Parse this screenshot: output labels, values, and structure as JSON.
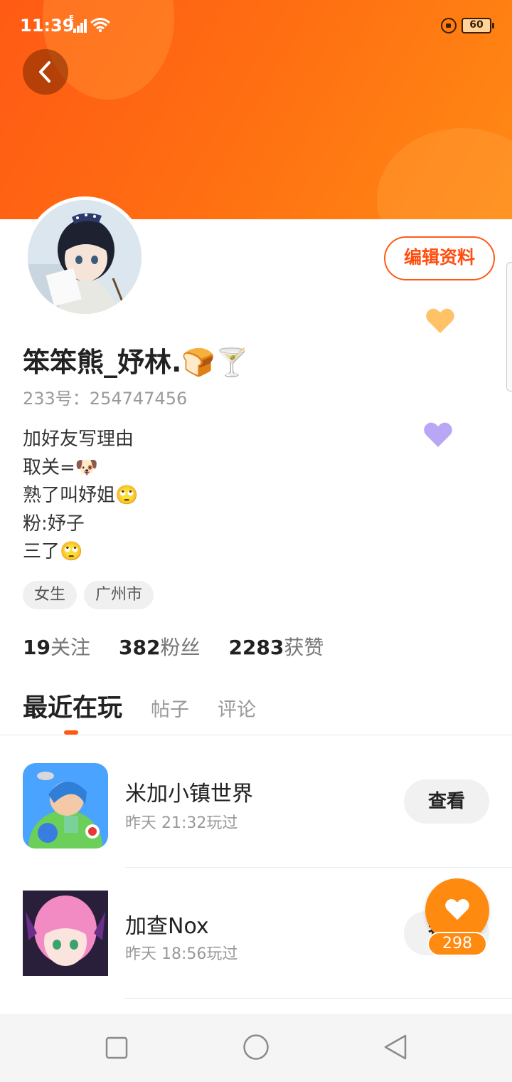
{
  "status_bar": {
    "time": "11:39",
    "network": "E",
    "battery": "60"
  },
  "profile": {
    "name": "笨笨熊_妤林.🍞🍸",
    "uid": "233号：254747456",
    "edit_label": "编辑资料",
    "bio": [
      "加好友写理由",
      "取关=🐶",
      "熟了叫妤姐🙄",
      "粉:妤子",
      "三了🙄"
    ],
    "tags": [
      "女生",
      "广州市"
    ]
  },
  "stats": [
    {
      "value": "19",
      "label": "关注"
    },
    {
      "value": "382",
      "label": "粉丝"
    },
    {
      "value": "2283",
      "label": "获赞"
    }
  ],
  "tabs": [
    {
      "label": "最近在玩",
      "active": true
    },
    {
      "label": "帖子",
      "active": false
    },
    {
      "label": "评论",
      "active": false
    }
  ],
  "games": [
    {
      "name": "米加小镇世界",
      "time": "昨天 21:32玩过",
      "button": "查看"
    },
    {
      "name": "加查Nox",
      "time": "昨天 18:56玩过",
      "button": "查看"
    }
  ],
  "like_fab": {
    "count": "298"
  },
  "colors": {
    "accent": "#ff5a14",
    "fab": "#ff8a10",
    "heart_orange": "#ffc266",
    "heart_purple": "#b9a6f5"
  },
  "icons": [
    "back-arrow-icon",
    "heart-icon",
    "square-nav-icon",
    "circle-nav-icon",
    "triangle-back-nav-icon"
  ]
}
